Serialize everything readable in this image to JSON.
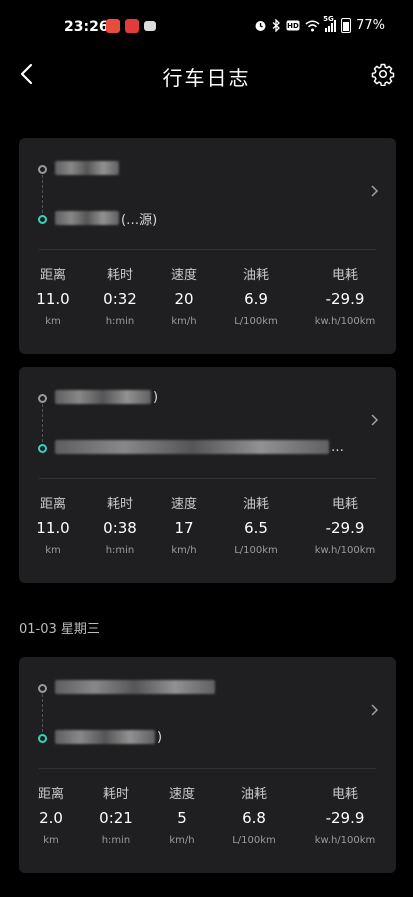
{
  "status_bar": {
    "time": "23:26",
    "battery": "77%",
    "network": "5G",
    "app_icon_colors": [
      "#e94b3c",
      "#e23b3b",
      "#dddddd"
    ]
  },
  "header": {
    "title": "行车日志",
    "back_icon": "back-icon",
    "settings_icon": "gear-icon"
  },
  "trips": [
    {
      "start_suffix": "",
      "end_suffix": "(…源)",
      "stats": [
        {
          "label": "距离",
          "value": "11.0",
          "unit": "km"
        },
        {
          "label": "耗时",
          "value": "0:32",
          "unit": "h:min"
        },
        {
          "label": "速度",
          "value": "20",
          "unit": "km/h"
        },
        {
          "label": "油耗",
          "value": "6.9",
          "unit": "L/100km"
        },
        {
          "label": "电耗",
          "value": "-29.9",
          "unit": "kw.h/100km"
        }
      ]
    },
    {
      "start_suffix": ")",
      "end_suffix": "…",
      "stats": [
        {
          "label": "距离",
          "value": "11.0",
          "unit": "km"
        },
        {
          "label": "耗时",
          "value": "0:38",
          "unit": "h:min"
        },
        {
          "label": "速度",
          "value": "17",
          "unit": "km/h"
        },
        {
          "label": "油耗",
          "value": "6.5",
          "unit": "L/100km"
        },
        {
          "label": "电耗",
          "value": "-29.9",
          "unit": "kw.h/100km"
        }
      ]
    },
    {
      "start_suffix": "",
      "end_suffix": ")",
      "stats": [
        {
          "label": "距离",
          "value": "2.0",
          "unit": "km"
        },
        {
          "label": "耗时",
          "value": "0:21",
          "unit": "h:min"
        },
        {
          "label": "速度",
          "value": "5",
          "unit": "km/h"
        },
        {
          "label": "油耗",
          "value": "6.8",
          "unit": "L/100km"
        },
        {
          "label": "电耗",
          "value": "-29.9",
          "unit": "kw.h/100km"
        }
      ]
    }
  ],
  "date_headers": [
    "01-03 星期三"
  ]
}
